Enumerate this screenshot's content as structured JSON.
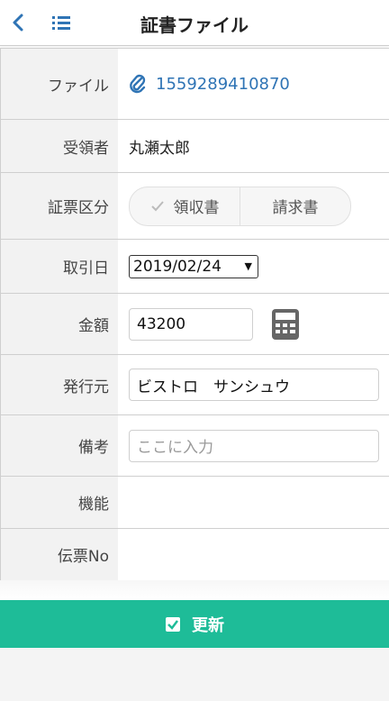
{
  "header": {
    "title": "証書ファイル"
  },
  "form": {
    "file": {
      "label": "ファイル",
      "value": "1559289410870"
    },
    "recipient": {
      "label": "受領者",
      "value": "丸瀬太郎"
    },
    "voucher_type": {
      "label": "証票区分",
      "options": [
        "領収書",
        "請求書"
      ],
      "selected": "領収書"
    },
    "trade_date": {
      "label": "取引日",
      "value": "2019/02/24"
    },
    "amount": {
      "label": "金額",
      "value": "43200"
    },
    "issuer": {
      "label": "発行元",
      "value": "ビストロ　サンシュウ"
    },
    "remarks": {
      "label": "備考",
      "placeholder": "ここに入力"
    },
    "function": {
      "label": "機能"
    },
    "slip_no": {
      "label": "伝票No"
    }
  },
  "update_button": {
    "label": "更新"
  },
  "colors": {
    "accent": "#2f74b5",
    "primary_button": "#1ebc98"
  },
  "icons": [
    "back-icon",
    "list-icon",
    "paperclip-icon",
    "check-icon",
    "calculator-icon",
    "checkbox-icon"
  ]
}
